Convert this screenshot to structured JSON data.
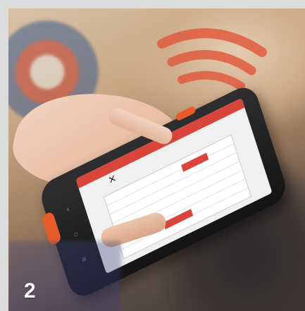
{
  "badge_number": "2",
  "colors": {
    "accent": "#e85b2a",
    "screen_red": "#d9453a",
    "frame": "#dcdcdc"
  },
  "icons": [
    "wifi-signal-icon",
    "close-icon",
    "back-icon",
    "home-icon",
    "menu-icon",
    "plus-icon"
  ]
}
